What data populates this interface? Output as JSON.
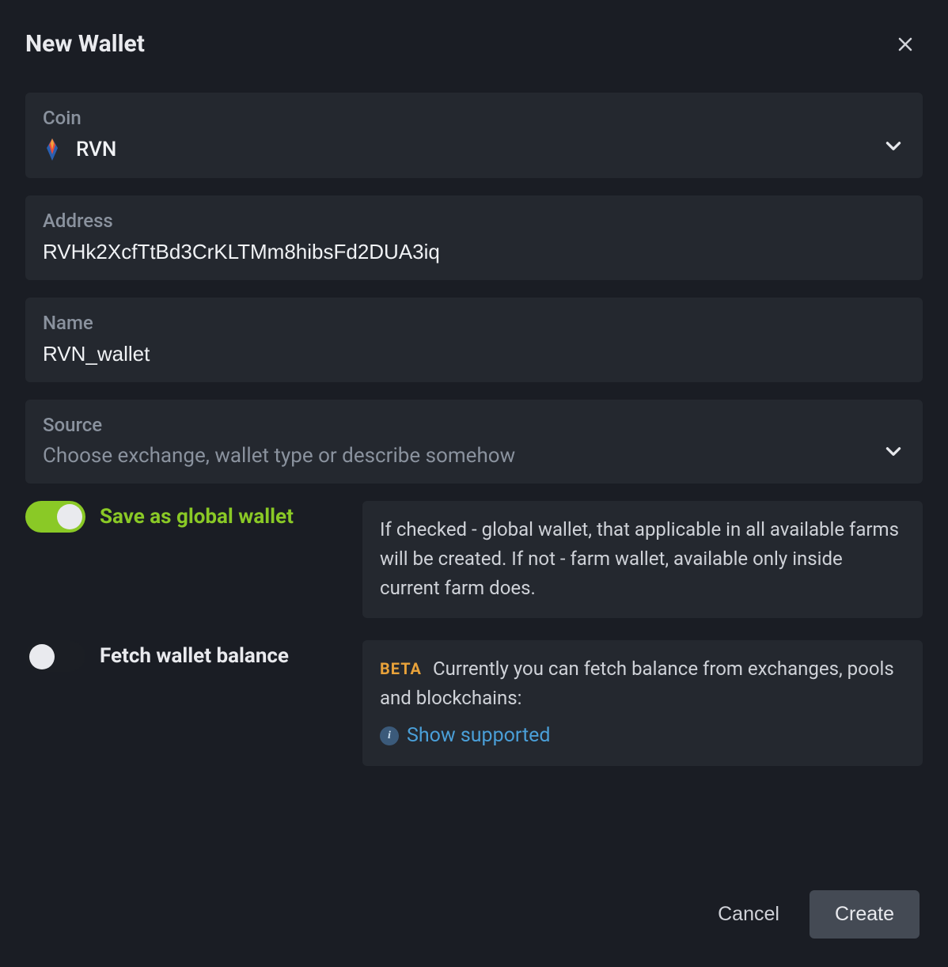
{
  "modal": {
    "title": "New Wallet"
  },
  "fields": {
    "coin": {
      "label": "Coin",
      "value": "RVN"
    },
    "address": {
      "label": "Address",
      "value": "RVHk2XcfTtBd3CrKLTMm8hibsFd2DUA3iq"
    },
    "name": {
      "label": "Name",
      "value": "RVN_wallet"
    },
    "source": {
      "label": "Source",
      "placeholder": "Choose exchange, wallet type or describe somehow"
    }
  },
  "toggles": {
    "global": {
      "label": "Save as global wallet",
      "on": true,
      "info": "If checked - global wallet, that applicable in all available farms will be created. If not - farm wallet, available only inside current farm does."
    },
    "fetch": {
      "label": "Fetch wallet balance",
      "on": false,
      "beta": "BETA",
      "info": "Currently you can fetch balance from exchanges, pools and blockchains:",
      "link": "Show supported"
    }
  },
  "footer": {
    "cancel": "Cancel",
    "create": "Create"
  }
}
